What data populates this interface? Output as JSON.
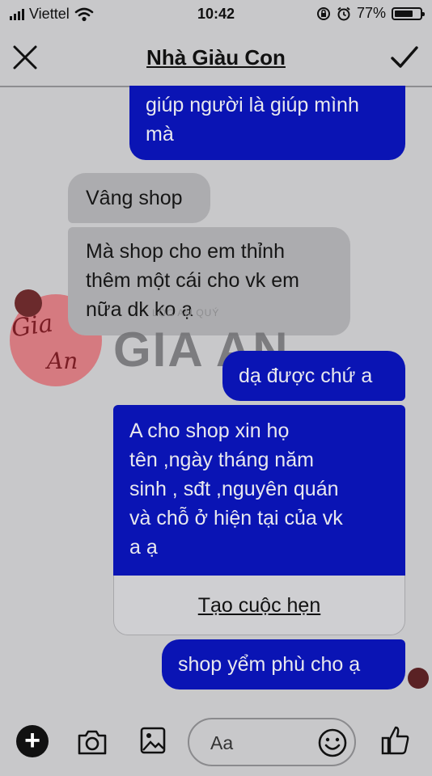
{
  "status_bar": {
    "carrier": "Viettel",
    "time": "10:42",
    "battery_percent": "77%",
    "battery_level": 0.77,
    "icons": [
      "signal-icon",
      "wifi-icon",
      "rotation-lock-icon",
      "alarm-icon",
      "battery-icon"
    ]
  },
  "header": {
    "title": "Nhà Giàu Con",
    "close_icon": "close-icon",
    "done_icon": "checkmark-icon"
  },
  "messages": [
    {
      "direction": "outgoing",
      "text": "giúp người là giúp mình\nmà"
    },
    {
      "direction": "incoming",
      "text": "Vâng shop"
    },
    {
      "direction": "incoming",
      "text": "Mà shop cho em thỉnh\nthêm một cái cho vk em\nnữa dk ko ạ"
    },
    {
      "direction": "outgoing",
      "text": "dạ được chứ a"
    },
    {
      "direction": "outgoing",
      "text": "A cho shop xin họ\ntên ,ngày tháng năm\nsinh , sđt ,nguyên quán\nvà chỗ ở hiện tại của vk\na ạ",
      "action_label": "Tạo cuộc hẹn"
    },
    {
      "direction": "outgoing",
      "text": "shop yểm phù cho ạ"
    }
  ],
  "watermark": {
    "main_text": "GIA AN",
    "small_text": "LỘC AN QUÝ",
    "script_top": "Gia",
    "script_bottom": "An"
  },
  "composer": {
    "placeholder": "Aa",
    "icons": [
      "plus-icon",
      "camera-icon",
      "image-icon",
      "emoji-icon",
      "like-icon"
    ]
  },
  "colors": {
    "outgoing_bubble": "#0a14b4",
    "incoming_bubble": "#acacaf",
    "background": "#c8c8ca",
    "watermark_circle": "#d76c73"
  }
}
